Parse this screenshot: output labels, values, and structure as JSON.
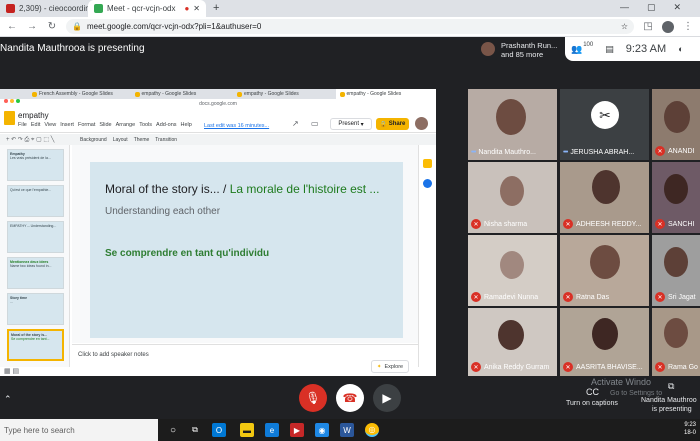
{
  "browser": {
    "tabs": [
      {
        "label": "2,309) - cieocoordinator@"
      },
      {
        "label": "Meet - qcr-vcjn-odx"
      }
    ],
    "url": "meet.google.com/qcr-vcjn-odx?pli=1&authuser=0"
  },
  "meet": {
    "presenting_banner": "Nandita Mauthrooa is presenting",
    "people_line1": "Prashanth Run...",
    "people_line2": "and 85 more",
    "people_count": "100",
    "time": "9:23 AM"
  },
  "slides": {
    "tabs": [
      {
        "label": "French Assembly - Google Slides"
      },
      {
        "label": "empathy - Google Slides"
      },
      {
        "label": "empathy - Google Slides"
      },
      {
        "label": "empathy - Google Slides"
      }
    ],
    "url": "docs.google.com",
    "doc_title": "empathy",
    "menu": [
      "File",
      "Edit",
      "View",
      "Insert",
      "Format",
      "Slide",
      "Arrange",
      "Tools",
      "Add-ons",
      "Help"
    ],
    "last_edit": "Last edit was 16 minutes...",
    "present_label": "Present",
    "share_label": "Share",
    "toolbar": [
      "Background",
      "Layout",
      "Theme",
      "Transition"
    ],
    "thumbs": [
      {
        "title": "Empathy",
        "text": "Les vrais président de la..."
      },
      {
        "title": "",
        "text": "Qu'est ce que l'empathie..."
      },
      {
        "title": "",
        "text": "EMPATHY -- Understanding..."
      },
      {
        "title": "Mentionnez deux idees",
        "text": "Name two ideas found in..."
      },
      {
        "title": "Story time",
        "text": "..."
      },
      {
        "title": "Moral of the story is...",
        "text": "Se comprendre en tant..."
      }
    ],
    "slide": {
      "title_en": "Moral of the story is... /",
      "title_fr": "La morale de l'histoire est ...",
      "subtitle": "Understanding each other",
      "body": "Se comprendre en tant qu'individu"
    },
    "notes_placeholder": "Click to add speaker notes",
    "explore_label": "Explore"
  },
  "participants": [
    {
      "name": "Nandita Mauthro...",
      "muted": false
    },
    {
      "name": "JERUSHA ABRAH...",
      "muted": false
    },
    {
      "name": "ANANDI",
      "muted": true
    },
    {
      "name": "Nisha sharma",
      "muted": true
    },
    {
      "name": "ADHEESH REDDY...",
      "muted": true
    },
    {
      "name": "SANCHI",
      "muted": true
    },
    {
      "name": "Ramadevi Nunna",
      "muted": true
    },
    {
      "name": "Ratna Das",
      "muted": true
    },
    {
      "name": "Sri Jagat",
      "muted": true
    },
    {
      "name": "Anika Reddy Gurram",
      "muted": true
    },
    {
      "name": "AASRITA BHAVISE...",
      "muted": true
    },
    {
      "name": "Rama Go",
      "muted": true
    }
  ],
  "bottom": {
    "captions_label": "Turn on captions",
    "presenter_line1": "Nandita Mauthroo",
    "presenter_line2": "is presenting",
    "activate_line1": "Activate Windo",
    "activate_line2": "Go to Settings to"
  },
  "taskbar": {
    "search_placeholder": "Type here to search",
    "clock_time": "9:23",
    "clock_date": "18-0"
  }
}
